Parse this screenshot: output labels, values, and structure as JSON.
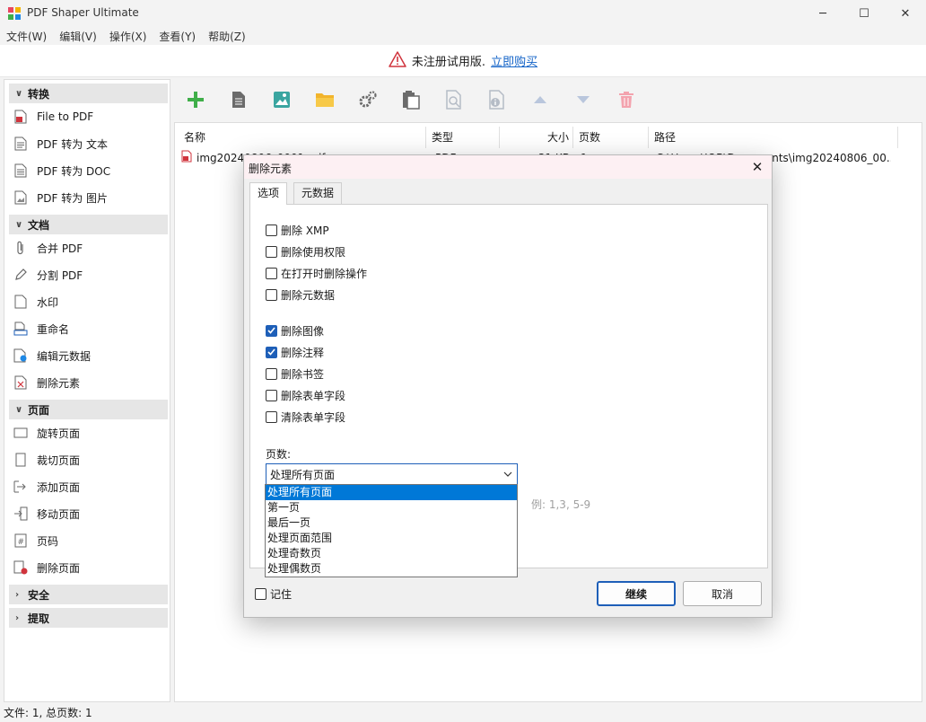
{
  "window": {
    "title": "PDF Shaper Ultimate",
    "minimize": "─",
    "maximize": "☐",
    "close": "✕"
  },
  "menu": [
    "文件(W)",
    "编辑(V)",
    "操作(X)",
    "查看(Y)",
    "帮助(Z)"
  ],
  "banner": {
    "text": "未注册试用版.",
    "link": "立即购买"
  },
  "sidebar": {
    "sections": [
      {
        "title": "转换",
        "expanded": true,
        "items": [
          "File to PDF",
          "PDF 转为 文本",
          "PDF 转为 DOC",
          "PDF 转为 图片"
        ]
      },
      {
        "title": "文档",
        "expanded": true,
        "items": [
          "合并 PDF",
          "分割 PDF",
          "水印",
          "重命名",
          "编辑元数据",
          "删除元素"
        ]
      },
      {
        "title": "页面",
        "expanded": true,
        "items": [
          "旋转页面",
          "裁切页面",
          "添加页面",
          "移动页面",
          "页码",
          "删除页面"
        ]
      },
      {
        "title": "安全",
        "expanded": false,
        "items": []
      },
      {
        "title": "提取",
        "expanded": false,
        "items": []
      }
    ]
  },
  "file_table": {
    "columns": [
      "名称",
      "类型",
      "大小",
      "页数",
      "路径"
    ],
    "rows": [
      {
        "name": "img20240806_0001.pdf",
        "type": "PDF",
        "size": "31 KB",
        "pages": "1",
        "path": "C:\\Users\\JOB\\Documents\\img20240806_00..."
      }
    ]
  },
  "status": {
    "text": "文件: 1, 总页数: 1"
  },
  "dialog": {
    "title": "删除元素",
    "close": "✕",
    "tabs": [
      "选项",
      "元数据"
    ],
    "options_group1": [
      {
        "label": "删除 XMP",
        "checked": false
      },
      {
        "label": "删除使用权限",
        "checked": false
      },
      {
        "label": "在打开时删除操作",
        "checked": false
      },
      {
        "label": "删除元数据",
        "checked": false
      }
    ],
    "options_group2": [
      {
        "label": "删除图像",
        "checked": true
      },
      {
        "label": "删除注释",
        "checked": true
      },
      {
        "label": "删除书签",
        "checked": false
      },
      {
        "label": "删除表单字段",
        "checked": false
      },
      {
        "label": "清除表单字段",
        "checked": false
      }
    ],
    "pages_label": "页数:",
    "pages_selected": "处理所有页面",
    "pages_options": [
      "处理所有页面",
      "第一页",
      "最后一页",
      "处理页面范围",
      "处理奇数页",
      "处理偶数页"
    ],
    "range_hint": "例: 1,3, 5-9",
    "remember_label": "记住",
    "remember_checked": false,
    "continue_label": "继续",
    "cancel_label": "取消"
  },
  "colors": {
    "accent": "#1e5fb8",
    "highlight": "#0078d7",
    "add_green": "#3fae49",
    "delete_red": "#e8475f",
    "link": "#1464c8"
  }
}
